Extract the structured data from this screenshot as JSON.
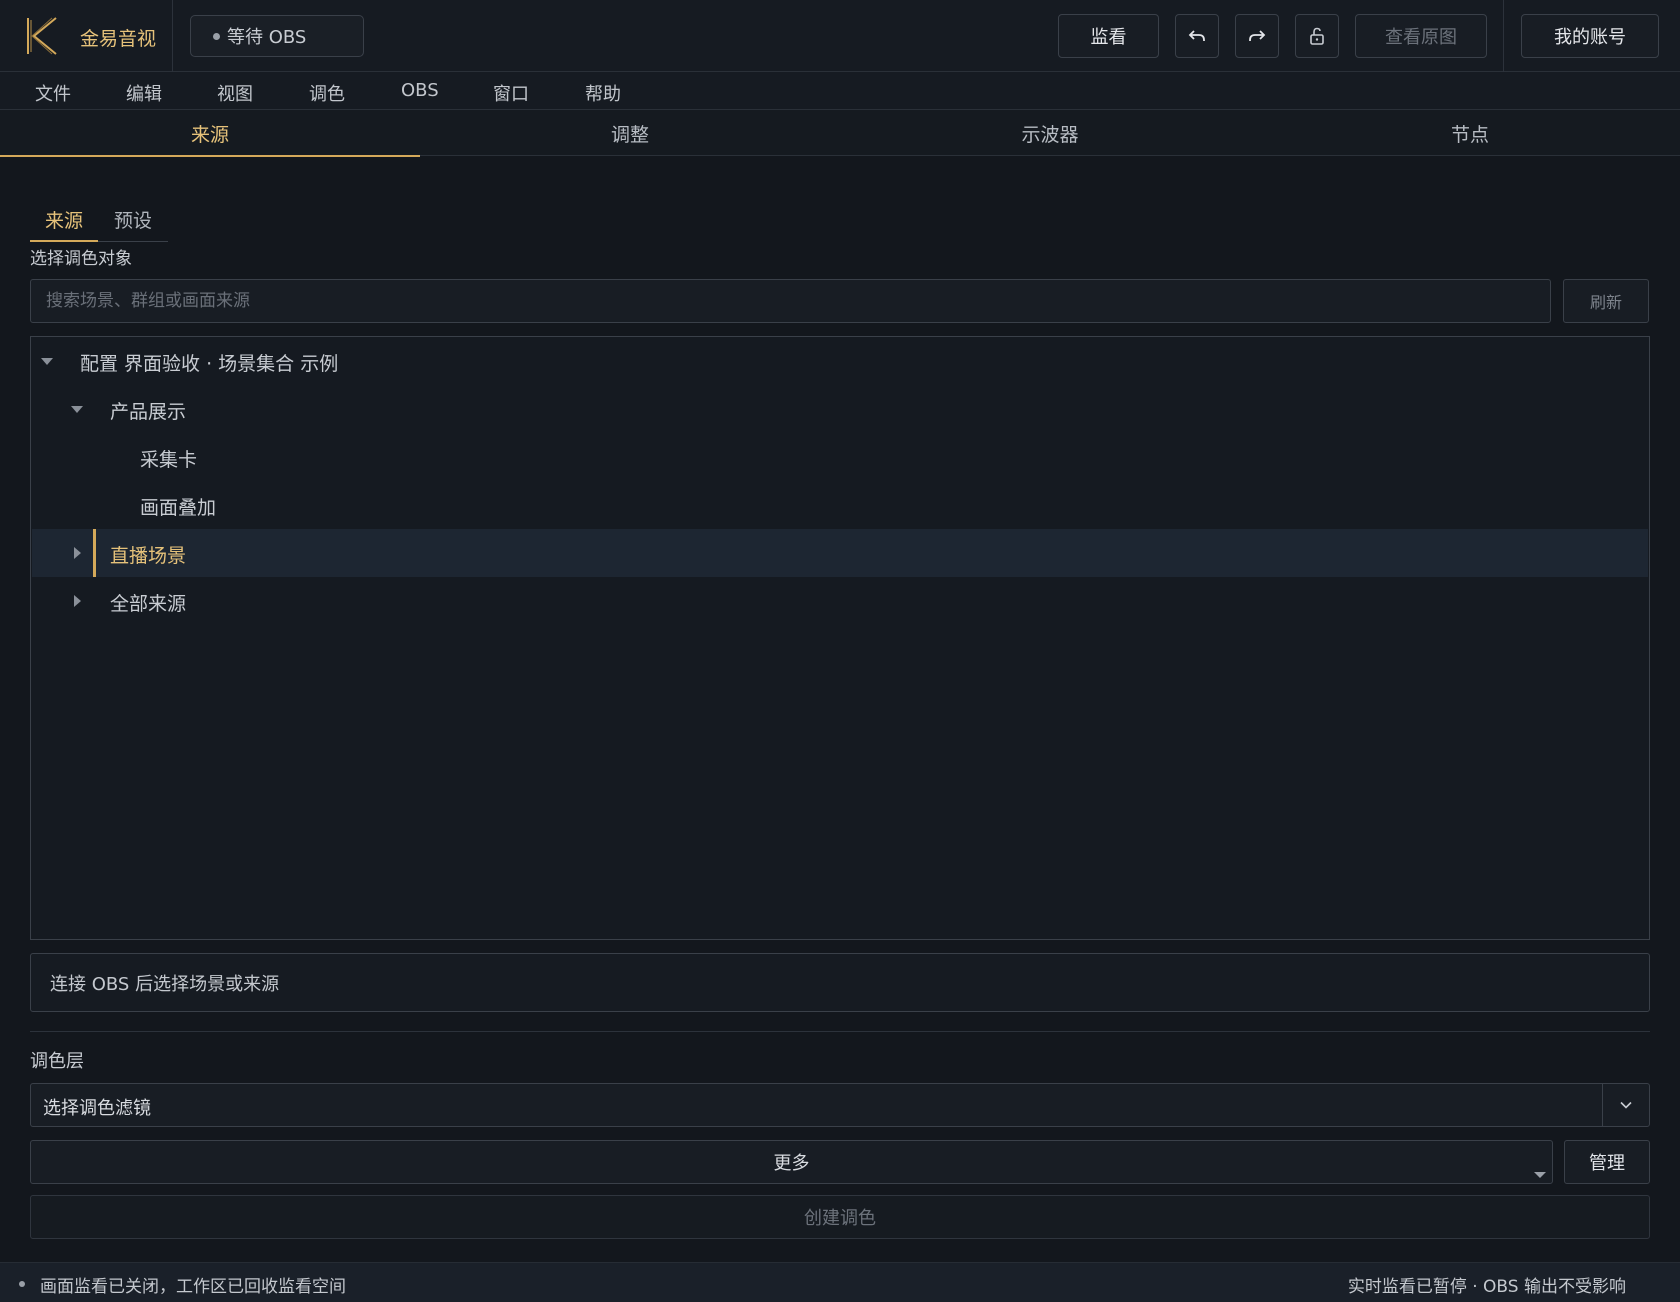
{
  "app": {
    "name": "金易音视",
    "obs_status": "等待 OBS"
  },
  "header": {
    "monitor_label": "监看",
    "undo_icon": "undo-icon",
    "redo_icon": "redo-icon",
    "lock_icon": "unlock-icon",
    "view_original_label": "查看原图",
    "account_label": "我的账号"
  },
  "menu": {
    "items": [
      "文件",
      "编辑",
      "视图",
      "调色",
      "OBS",
      "窗口",
      "帮助"
    ]
  },
  "main_tabs": {
    "items": [
      "来源",
      "调整",
      "示波器",
      "节点"
    ],
    "active": "来源"
  },
  "sub_tabs": {
    "items": [
      "来源",
      "预设"
    ],
    "active": "来源"
  },
  "source_panel": {
    "section_label": "选择调色对象",
    "search_placeholder": "搜索场景、群组或画面来源",
    "search_value": "",
    "refresh_label": "刷新",
    "tree": [
      {
        "label": "配置 界面验收 · 场景集合 示例",
        "level": 0,
        "state": "expanded"
      },
      {
        "label": "产品展示",
        "level": 1,
        "state": "expanded"
      },
      {
        "label": "采集卡",
        "level": 2,
        "state": "leaf"
      },
      {
        "label": "画面叠加",
        "level": 2,
        "state": "leaf"
      },
      {
        "label": "直播场景",
        "level": 1,
        "state": "collapsed",
        "selected": true
      },
      {
        "label": "全部来源",
        "level": 1,
        "state": "collapsed"
      }
    ],
    "hint": "连接 OBS 后选择场景或来源"
  },
  "layer_panel": {
    "label": "调色层",
    "filter_select_value": "选择调色滤镜",
    "more_label": "更多",
    "manage_label": "管理",
    "create_label": "创建调色"
  },
  "status_bar": {
    "left": "画面监看已关闭，工作区已回收监看空间",
    "right": "实时监看已暂停 · OBS 输出不受影响"
  },
  "colors": {
    "accent": "#d4a95a",
    "accent_text": "#e6c27a",
    "background": "#13171d"
  }
}
